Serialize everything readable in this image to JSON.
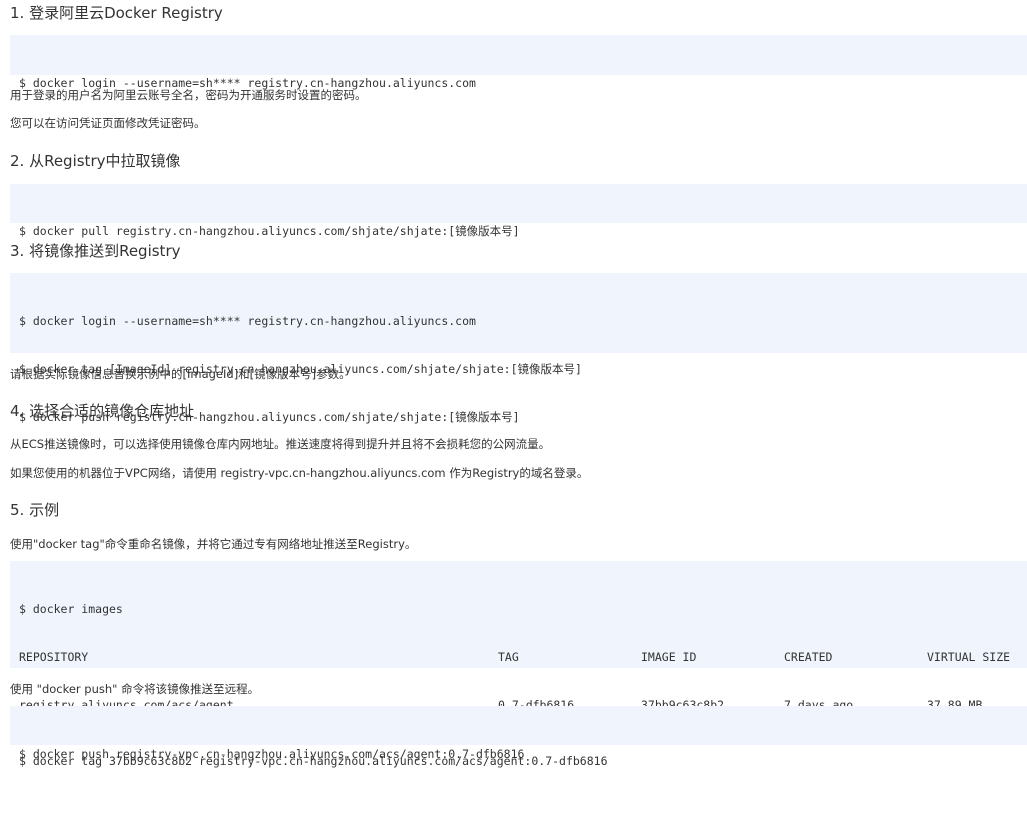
{
  "sections": [
    {
      "heading": "1. 登录阿里云Docker Registry",
      "code": [
        "$ docker login --username=sh**** registry.cn-hangzhou.aliyuncs.com"
      ],
      "paras": [
        "用于登录的用户名为阿里云账号全名，密码为开通服务时设置的密码。",
        "您可以在访问凭证页面修改凭证密码。"
      ]
    },
    {
      "heading": "2. 从Registry中拉取镜像",
      "code": [
        "$ docker pull registry.cn-hangzhou.aliyuncs.com/shjate/shjate:[镜像版本号]"
      ]
    },
    {
      "heading": "3. 将镜像推送到Registry",
      "code": [
        "$ docker login --username=sh**** registry.cn-hangzhou.aliyuncs.com",
        "$ docker tag [ImageId] registry.cn-hangzhou.aliyuncs.com/shjate/shjate:[镜像版本号]",
        "$ docker push registry.cn-hangzhou.aliyuncs.com/shjate/shjate:[镜像版本号]"
      ],
      "paras": [
        "请根据实际镜像信息替换示例中的[ImageId]和[镜像版本号]参数。"
      ]
    },
    {
      "heading": "4. 选择合适的镜像仓库地址",
      "paras": [
        "从ECS推送镜像时，可以选择使用镜像仓库内网地址。推送速度将得到提升并且将不会损耗您的公网流量。",
        "如果您使用的机器位于VPC网络，请使用 registry-vpc.cn-hangzhou.aliyuncs.com 作为Registry的域名登录。"
      ]
    },
    {
      "heading": "5. 示例",
      "paras": [
        "使用\"docker tag\"命令重命名镜像，并将它通过专有网络地址推送至Registry。",
        "使用 \"docker push\" 命令将该镜像推送至远程。"
      ],
      "example": {
        "images_cmd": "$ docker images",
        "table_headers": [
          "REPOSITORY",
          "TAG",
          "IMAGE ID",
          "CREATED",
          "VIRTUAL SIZE"
        ],
        "table_row": [
          "registry.aliyuncs.com/acs/agent",
          "0.7-dfb6816",
          "37bb9c63c8b2",
          "7 days ago",
          "37.89 MB"
        ],
        "tag_cmd": "$ docker tag 37bb9c63c8b2 registry-vpc.cn-hangzhou.aliyuncs.com/acs/agent:0.7-dfb6816",
        "push_cmd": "$ docker push registry-vpc.cn-hangzhou.aliyuncs.com/acs/agent:0.7-dfb6816"
      }
    }
  ]
}
